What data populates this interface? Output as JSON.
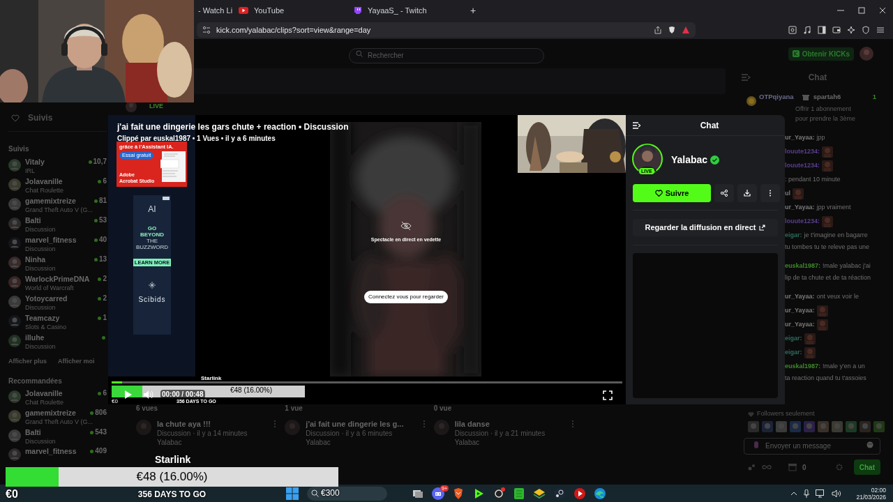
{
  "browser": {
    "tabs": [
      {
        "label": "- Watch Li",
        "selected": false
      },
      {
        "label": "YouTube",
        "selected": false
      },
      {
        "label": "YayaaS_ - Twitch",
        "selected": false
      }
    ],
    "new_tab": "+",
    "url": "kick.com/yalabac/clips?sort=view&range=day"
  },
  "header": {
    "search_placeholder": "Rechercher",
    "kicks_button": "Obtenir KICKs"
  },
  "sidebar": {
    "nav_item": "Suivis",
    "live_badge": "LIVE",
    "followed_title": "Suivis",
    "followed": [
      {
        "name": "Vitaly",
        "category": "IRL",
        "viewers": "10,7",
        "live": true
      },
      {
        "name": "Jolavanille",
        "category": "Chat Roulette",
        "viewers": "6",
        "live": true
      },
      {
        "name": "gamemixtreize",
        "category": "Grand Theft Auto V (G...",
        "viewers": "81",
        "live": true
      },
      {
        "name": "Balti",
        "category": "Discussion",
        "viewers": "53",
        "live": true
      },
      {
        "name": "marvel_fitness",
        "category": "Discussion",
        "viewers": "40",
        "live": true
      },
      {
        "name": "Ninha",
        "category": "Discussion",
        "viewers": "13",
        "live": true
      },
      {
        "name": "WarlockPrimeDNA",
        "category": "World of Warcraft",
        "viewers": "2",
        "live": true
      },
      {
        "name": "Yotoycarred",
        "category": "Discussion",
        "viewers": "2",
        "live": true
      },
      {
        "name": "Teamcazy",
        "category": "Slots & Casino",
        "viewers": "1",
        "live": true
      },
      {
        "name": "illuhe",
        "category": "Discussion",
        "live": true
      }
    ],
    "show_more": "Afficher plus",
    "show_less": "Afficher moi",
    "recommended_title": "Recommandées",
    "recommended": [
      {
        "name": "Jolavanille",
        "category": "Chat Roulette",
        "viewers": "6",
        "live": true
      },
      {
        "name": "gamemixtreize",
        "category": "Grand Theft Auto V (G...",
        "viewers": "806",
        "live": true
      },
      {
        "name": "Balti",
        "category": "Discussion",
        "viewers": "543",
        "live": true
      },
      {
        "name": "marvel_fitness",
        "viewers": "409",
        "live": true
      }
    ]
  },
  "clip": {
    "title": "j'ai fait une dingerie les gars chute + reaction • Discussion",
    "byline": "Clippé par euskal1987 • 1 Vues • il y a 6 minutes",
    "offline_title": "Spectacle en direct en vedette",
    "login_button": "Connectez vous pour regarder",
    "progress": {
      "level": 0.02
    },
    "time": "00:00 / 00:48"
  },
  "ad_adobe": {
    "headline": "grâce à l'Assistant IA.",
    "button": "Essai gratuit",
    "brand": "Adobe",
    "product": "Acrobat Studio"
  },
  "ad_scibids": {
    "lines": [
      "AI",
      "GO",
      "BEYOND",
      "THE",
      "BUZZWORD"
    ],
    "button": "LEARN MORE",
    "brand": "Scibids"
  },
  "channel_panel": {
    "title": "Chat",
    "name": "Yalabac",
    "verified": true,
    "live_badge": "LIVE",
    "follow_button": "Suivre",
    "watch_live_button": "Regarder la diffusion en direct"
  },
  "clips": [
    {
      "views": "6 vues",
      "title": "la chute aya !!!",
      "meta": "Discussion · il y a 14 minutes",
      "channel": "Yalabac"
    },
    {
      "views": "1 vue",
      "title": "j'ai fait une dingerie les g...",
      "meta": "Discussion · il y a 6 minutes",
      "channel": "Yalabac"
    },
    {
      "views": "0 vue",
      "title": "lila danse",
      "meta": "Discussion · il y a 21 minutes",
      "channel": "Yalabac"
    }
  ],
  "chat": {
    "title": "Chat",
    "gift": {
      "gifter": "OTPqiyana",
      "recipient": "spartah6",
      "count": "1",
      "line_1": "Offrir 1 abonnement",
      "line_2": "pour prendre la 3ème"
    },
    "messages": [
      {
        "user": "ur_Yayaa:",
        "text": "jpp",
        "color": "#7a7a7a",
        "emote": false
      },
      {
        "user": "louute1234:",
        "color": "#5a3f8f",
        "emote": true
      },
      {
        "user": "louute1234:",
        "color": "#5a3f8f",
        "emote": true
      },
      {
        "text": ": pendant 10 minute",
        "emote": false
      },
      {
        "user": "ul",
        "color": "#7a7a7a",
        "emote": true
      },
      {
        "user": "ur_Yayaa:",
        "text": "jpp vraiment",
        "color": "#7a7a7a",
        "emote": false
      },
      {
        "user": "louute1234:",
        "color": "#5a3f8f",
        "emote": true
      },
      {
        "user": "eigar:",
        "text": "je t'imagine en bagarre",
        "continuation": [
          "tu tombes tu te releve pas une"
        ],
        "color": "#2f6b5a",
        "emote": false
      },
      {
        "user": "euskal1987:",
        "text": "!male yalabac j'ai",
        "continuation": [
          "lip de ta chute et de ta réaction"
        ],
        "color": "#3f8a2a",
        "emote": false
      },
      {
        "user": "ur_Yayaa:",
        "text": "ont veux voir le",
        "color": "#7a7a7a",
        "emote": false
      },
      {
        "user": "ur_Yayaa:",
        "color": "#7a7a7a",
        "emote": true
      },
      {
        "user": "ur_Yayaa:",
        "color": "#7a7a7a",
        "emote": true
      },
      {
        "user": "eigar:",
        "color": "#2f6b5a",
        "emote": true
      },
      {
        "user": "eigar:",
        "color": "#2f6b5a",
        "emote": true
      },
      {
        "user": "euskal1987:",
        "text": "!male y'en a un",
        "continuation": [
          "ta reaction quand tu t'assoies"
        ],
        "color": "#3f8a2a",
        "emote": false
      }
    ],
    "followers_only": "Followers seulement",
    "input_placeholder": "Envoyer un message",
    "points": "0",
    "send_button": "Chat"
  },
  "player_goal": {
    "label": "Starlink",
    "amount": "€48 (16.00%)",
    "level": 0.16,
    "start": "€0",
    "remaining": "356 DAYS TO GO"
  },
  "goal_overlay": {
    "label": "Starlink",
    "amount": "€48 (16.00%)",
    "level": 0.16,
    "start": "€0",
    "remaining": "356 DAYS TO GO",
    "target": "€300"
  },
  "taskbar": {
    "notification_badge": "9+",
    "time": "02:00",
    "date": "21/03/2026"
  }
}
